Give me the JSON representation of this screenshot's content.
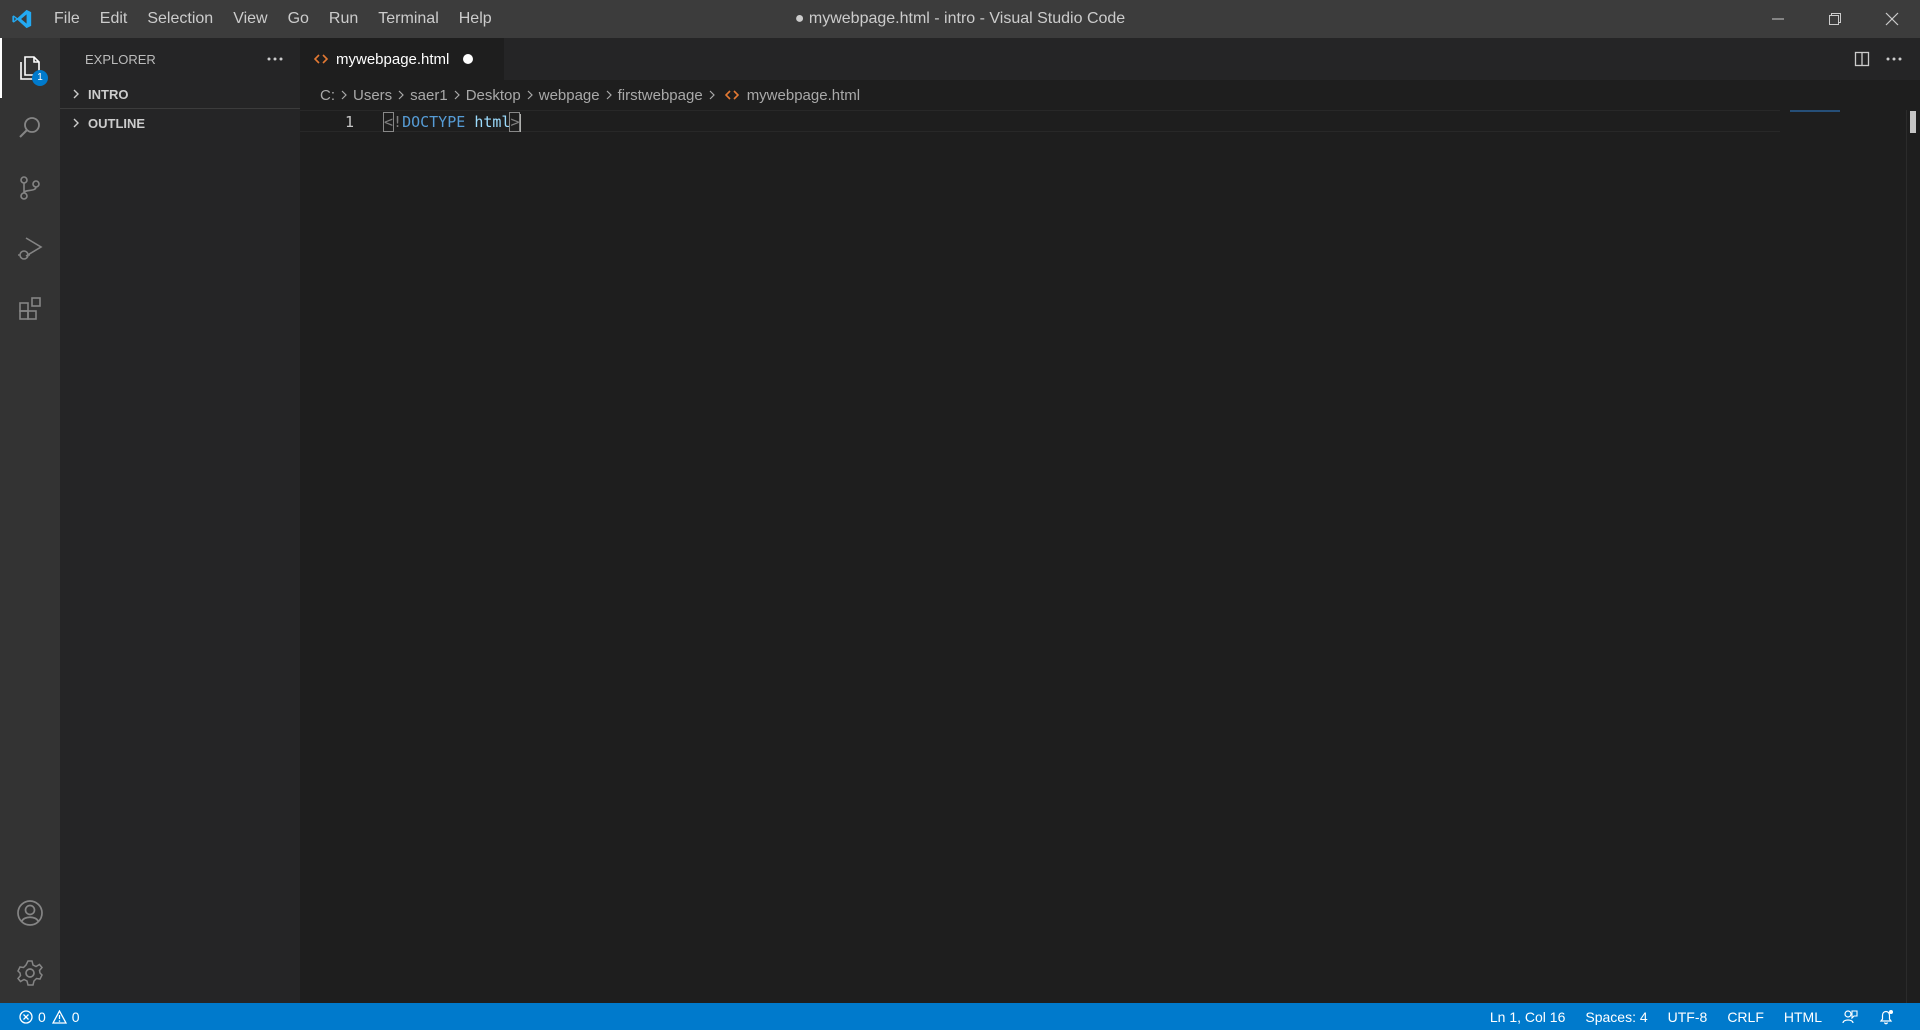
{
  "window": {
    "title": "● mywebpage.html - intro - Visual Studio Code"
  },
  "menu": [
    "File",
    "Edit",
    "Selection",
    "View",
    "Go",
    "Run",
    "Terminal",
    "Help"
  ],
  "activity": {
    "items": [
      "explorer",
      "search",
      "source-control",
      "run-debug",
      "extensions"
    ],
    "explorer_badge": "1"
  },
  "sidebar": {
    "title": "EXPLORER",
    "sections": [
      "INTRO",
      "OUTLINE"
    ]
  },
  "tab": {
    "label": "mywebpage.html",
    "dirty": true
  },
  "breadcrumb": [
    "C:",
    "Users",
    "saer1",
    "Desktop",
    "webpage",
    "firstwebpage",
    "mywebpage.html"
  ],
  "editor": {
    "line_number": "1",
    "tokens": {
      "open": "<",
      "bang": "!",
      "doctype": "DOCTYPE",
      "space": " ",
      "name": "html",
      "close": ">"
    }
  },
  "statusbar": {
    "errors": "0",
    "warnings": "0",
    "position": "Ln 1, Col 16",
    "indent": "Spaces: 4",
    "encoding": "UTF-8",
    "eol": "CRLF",
    "language": "HTML"
  },
  "colors": {
    "accent": "#007acc",
    "html_icon": "#e37933"
  }
}
